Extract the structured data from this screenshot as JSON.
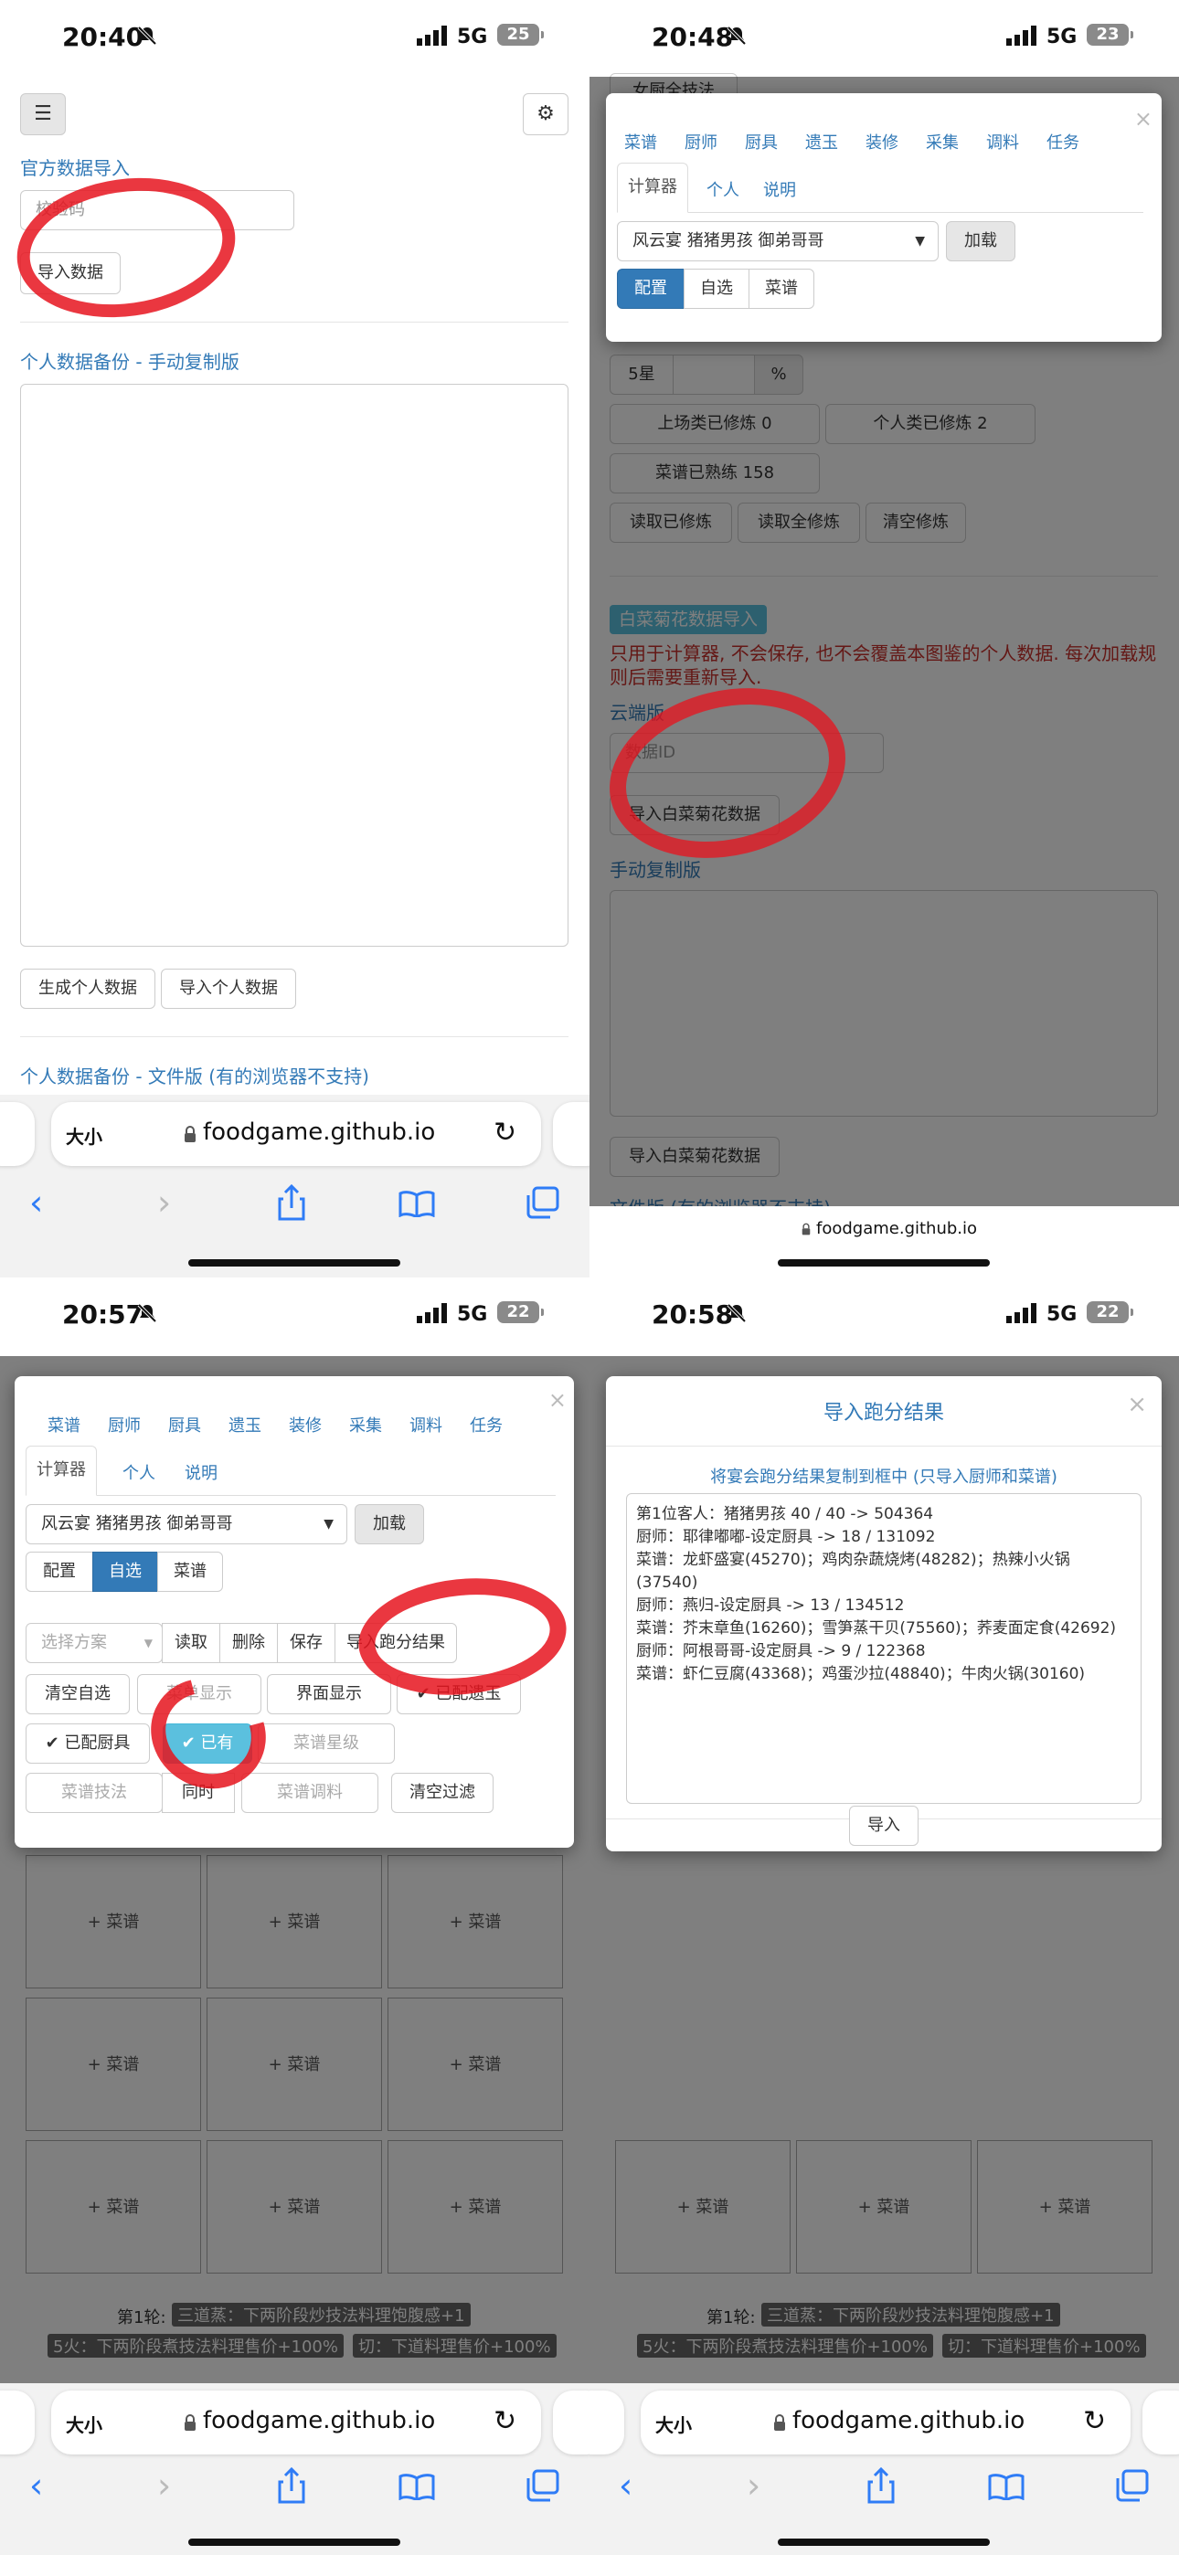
{
  "status_bars": [
    {
      "time": "20:40",
      "network": "5G",
      "battery": "25"
    },
    {
      "time": "20:48",
      "network": "5G",
      "battery": "23"
    },
    {
      "time": "20:57",
      "network": "5G",
      "battery": "22"
    },
    {
      "time": "20:58",
      "network": "5G",
      "battery": "22"
    }
  ],
  "browser": {
    "text_size": "大小",
    "url": "foodgame.github.io"
  },
  "panel1": {
    "official_import_title": "官方数据导入",
    "verify_placeholder": "校验码",
    "import_data_btn": "导入数据",
    "backup_manual_title": "个人数据备份 - 手动复制版",
    "gen_personal_btn": "生成个人数据",
    "import_personal_btn": "导入个人数据",
    "backup_file_title": "个人数据备份 - 文件版 (有的浏览器不支持)"
  },
  "calc_tabs": {
    "top": [
      "菜谱",
      "厨师",
      "厨具",
      "遗玉",
      "装修",
      "采集",
      "调料",
      "任务"
    ],
    "second": [
      "计算器",
      "个人",
      "说明"
    ],
    "banquet": "风云宴 猪猪男孩 御弟哥哥",
    "load": "加载",
    "modes": [
      "配置",
      "自选",
      "菜谱"
    ],
    "close": "×"
  },
  "panel2": {
    "top_btn": "女厨全技法",
    "star5": "5星",
    "percent": "%",
    "onstage": "上场类已修炼 0",
    "personal": "个人类已修炼 2",
    "recipe_mastered": "菜谱已熟练 158",
    "read_practiced": "读取已修炼",
    "read_all": "读取全修炼",
    "clear_practiced": "清空修炼",
    "bcj_badge": "白菜菊花数据导入",
    "warning": "只用于计算器, 不会保存, 也不会覆盖本图鉴的个人数据. 每次加载规则后需要重新导入.",
    "cloud_title": "云端版",
    "data_id_placeholder": "数据ID",
    "import_bcj_btn": "导入白菜菊花数据",
    "manual_title": "手动复制版",
    "import_bcj_btn2": "导入白菜菊花数据",
    "file_title": "文件版 (有的浏览器不支持)",
    "footer_url": "foodgame.github.io"
  },
  "panel3": {
    "scheme_placeholder": "选择方案",
    "read": "读取",
    "delete": "删除",
    "save": "保存",
    "import_result": "导入跑分结果",
    "clear_self": "清空自选",
    "menu_show": "菜单显示",
    "ui_show": "界面显示",
    "jade_equipped": "✔ 已配遗玉",
    "tool_equipped": "✔ 已配厨具",
    "owned": "✔ 已有",
    "recipe_rarity": "菜谱星级",
    "recipe_skill": "菜谱技法",
    "simultaneous": "同时",
    "recipe_seasoning": "菜谱调料",
    "clear_filter": "清空过滤",
    "add_recipe": "+ 菜谱",
    "rounds": [
      "第1轮:",
      "三道蒸：下两阶段炒技法料理饱腹感+1",
      "5火：下两阶段煮技法料理售价+100%",
      "切：下道料理售价+100%"
    ]
  },
  "panel4": {
    "title": "导入跑分结果",
    "close": "×",
    "hint": "将宴会跑分结果复制到框中 (只导入厨师和菜谱)",
    "result_lines": [
      "第1位客人：猪猪男孩 40 / 40 -> 504364",
      "厨师：耶律嘟嘟-设定厨具 -> 18 / 131092",
      "菜谱：龙虾盛宴(45270)；鸡肉杂蔬烧烤(48282)；热辣小火锅",
      "(37540)",
      "厨师：燕归-设定厨具 -> 13 / 134512",
      "菜谱：芥末章鱼(16260)；雪笋蒸干贝(75560)；荞麦面定食(42692)",
      "厨师：阿根哥哥-设定厨具 -> 9 / 122368",
      "菜谱：虾仁豆腐(43368)；鸡蛋沙拉(48840)；牛肉火锅(30160)"
    ],
    "import_btn": "导入"
  },
  "colors": {
    "link": "#337ab7",
    "primary": "#337ab7",
    "owned": "#5bc0de",
    "annotation": "#e6141e"
  }
}
